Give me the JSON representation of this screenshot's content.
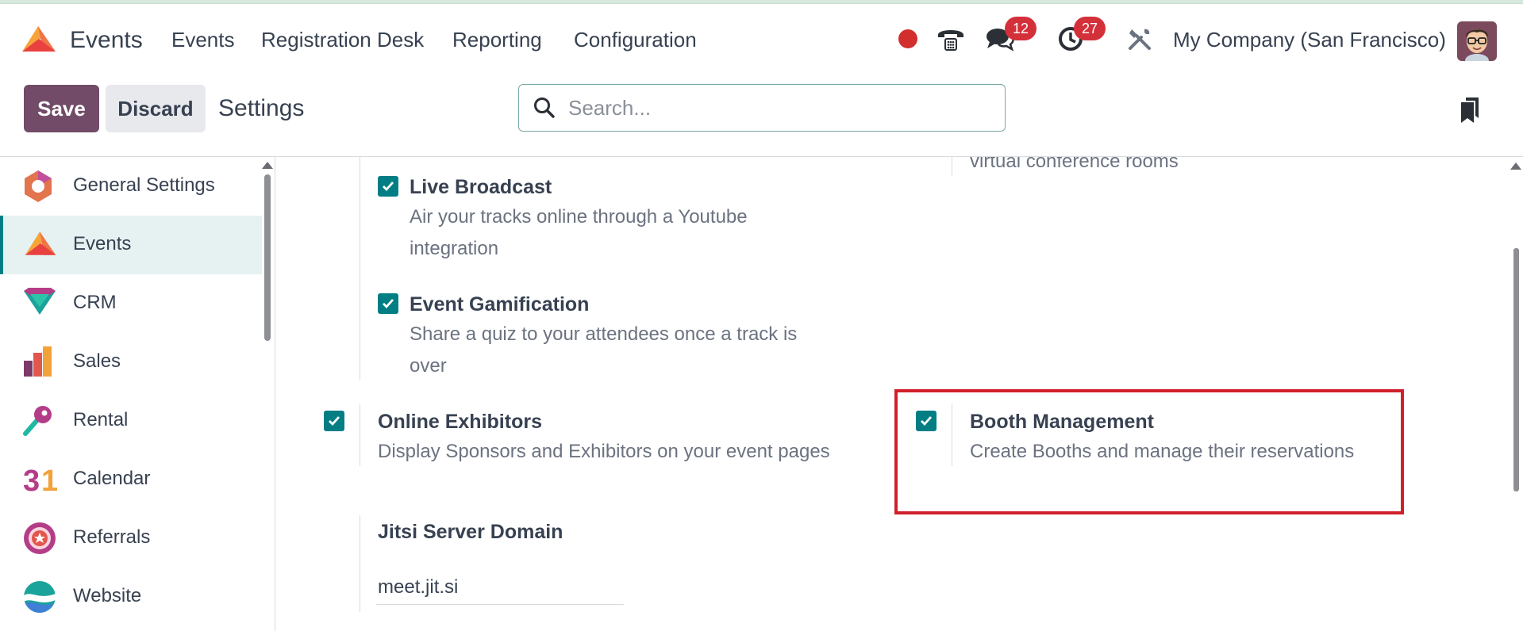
{
  "app": {
    "title": "Events",
    "menus": [
      "Events",
      "Registration Desk",
      "Reporting",
      "Configuration"
    ]
  },
  "systray": {
    "messages_count": "12",
    "activities_count": "27",
    "company": "My Company (San Francisco)"
  },
  "control_panel": {
    "save_label": "Save",
    "discard_label": "Discard",
    "breadcrumb": "Settings",
    "search_placeholder": "Search..."
  },
  "sidebar": {
    "items": [
      {
        "label": "General Settings",
        "icon": "general-settings-icon"
      },
      {
        "label": "Events",
        "icon": "events-icon",
        "active": true
      },
      {
        "label": "CRM",
        "icon": "crm-icon"
      },
      {
        "label": "Sales",
        "icon": "sales-icon"
      },
      {
        "label": "Rental",
        "icon": "rental-icon"
      },
      {
        "label": "Calendar",
        "icon": "calendar-icon"
      },
      {
        "label": "Referrals",
        "icon": "referrals-icon"
      },
      {
        "label": "Website",
        "icon": "website-icon"
      }
    ]
  },
  "settings": {
    "partial_right_desc": "virtual conference rooms",
    "live_broadcast": {
      "title": "Live Broadcast",
      "desc_line1": "Air your tracks online through a Youtube",
      "desc_line2": "integration",
      "checked": true
    },
    "event_gamification": {
      "title": "Event Gamification",
      "desc_line1": "Share a quiz to your attendees once a track is",
      "desc_line2": "over",
      "checked": true
    },
    "online_exhibitors": {
      "title": "Online Exhibitors",
      "desc": "Display Sponsors and Exhibitors on your event pages",
      "checked": true
    },
    "booth_management": {
      "title": "Booth Management",
      "desc": "Create Booths and manage their reservations",
      "checked": true
    },
    "jitsi": {
      "title": "Jitsi Server Domain",
      "value": "meet.jit.si"
    }
  },
  "colors": {
    "primary": "#714b67",
    "accent": "#017e84",
    "highlight": "#d11f2c",
    "badge": "#d4303a"
  }
}
